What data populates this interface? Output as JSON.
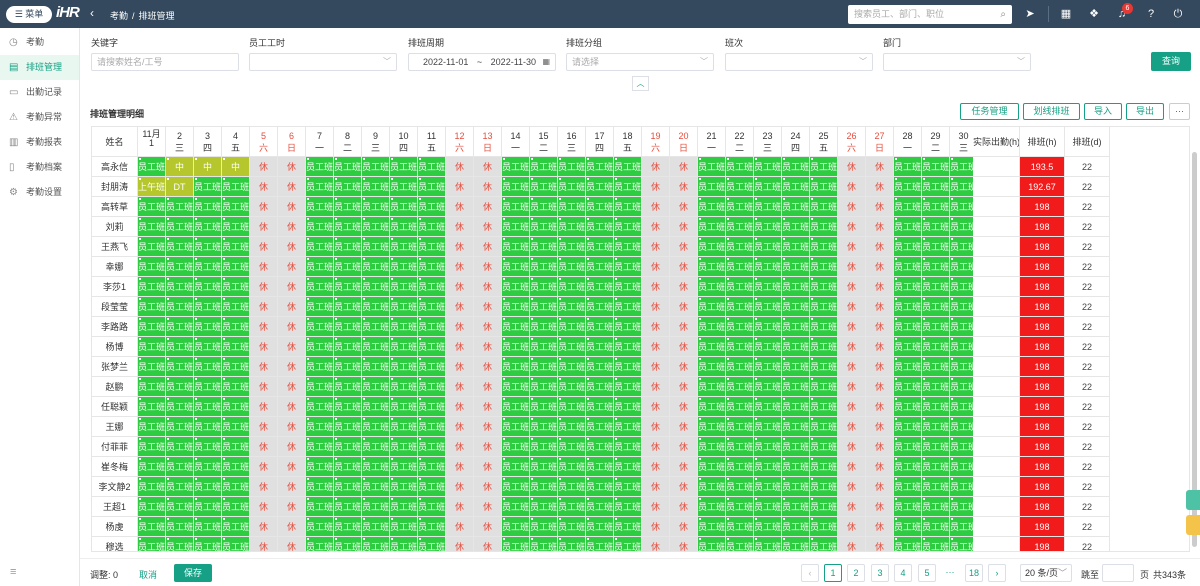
{
  "topbar": {
    "menu_label": "☰ 菜单",
    "logo": "iHR",
    "crumbs": [
      "考勤",
      "排班管理"
    ],
    "search_placeholder": "搜索员工、部门、职位",
    "notification_count": "6"
  },
  "sidebar": {
    "items": [
      {
        "label": "考勤",
        "icon": "clock-icon"
      },
      {
        "label": "排班管理",
        "icon": "calendar-icon",
        "active": true
      },
      {
        "label": "出勤记录",
        "icon": "list-icon"
      },
      {
        "label": "考勤异常",
        "icon": "alert-icon"
      },
      {
        "label": "考勤报表",
        "icon": "chart-icon"
      },
      {
        "label": "考勤档案",
        "icon": "file-icon"
      },
      {
        "label": "考勤设置",
        "icon": "gear-icon"
      }
    ]
  },
  "filters": {
    "keyword_label": "关键字",
    "keyword_placeholder": "请搜索姓名/工号",
    "hours_label": "员工工时",
    "period_label": "排班周期",
    "date_from": "2022-11-01",
    "date_sep": "~",
    "date_to": "2022-11-30",
    "group_label": "排班分组",
    "group_placeholder": "请选择",
    "shift_label": "班次",
    "dept_label": "部门",
    "query_label": "查询"
  },
  "panel": {
    "title": "排班管理明细",
    "buttons": [
      "任务管理",
      "划线排班",
      "导入",
      "导出",
      "···"
    ]
  },
  "table": {
    "name_header": "姓名",
    "month_label": "11月",
    "days": [
      {
        "d": "1",
        "w": "二"
      },
      {
        "d": "2",
        "w": "三"
      },
      {
        "d": "3",
        "w": "四"
      },
      {
        "d": "4",
        "w": "五"
      },
      {
        "d": "5",
        "w": "六"
      },
      {
        "d": "6",
        "w": "日"
      },
      {
        "d": "7",
        "w": "一"
      },
      {
        "d": "8",
        "w": "二"
      },
      {
        "d": "9",
        "w": "三"
      },
      {
        "d": "10",
        "w": "四"
      },
      {
        "d": "11",
        "w": "五"
      },
      {
        "d": "12",
        "w": "六"
      },
      {
        "d": "13",
        "w": "日"
      },
      {
        "d": "14",
        "w": "一"
      },
      {
        "d": "15",
        "w": "二"
      },
      {
        "d": "16",
        "w": "三"
      },
      {
        "d": "17",
        "w": "四"
      },
      {
        "d": "18",
        "w": "五"
      },
      {
        "d": "19",
        "w": "六"
      },
      {
        "d": "20",
        "w": "日"
      },
      {
        "d": "21",
        "w": "一"
      },
      {
        "d": "22",
        "w": "二"
      },
      {
        "d": "23",
        "w": "三"
      },
      {
        "d": "24",
        "w": "四"
      },
      {
        "d": "25",
        "w": "五"
      },
      {
        "d": "26",
        "w": "六"
      },
      {
        "d": "27",
        "w": "日"
      },
      {
        "d": "28",
        "w": "一"
      },
      {
        "d": "29",
        "w": "二"
      },
      {
        "d": "30",
        "w": "三"
      }
    ],
    "col_actual": "实际出勤(h)",
    "col_sched_h": "排班(h)",
    "col_sched_d": "排班(d)",
    "work_label": "员工班",
    "rest_label": "休",
    "rows": [
      {
        "name": "高永信",
        "special": [
          "员工班",
          "中",
          "中",
          "中"
        ],
        "h": "193.5",
        "d": "22"
      },
      {
        "name": "封朋涛",
        "special": [
          "上午班",
          "DT",
          "员工班",
          "员工班"
        ],
        "h": "192.67",
        "d": "22"
      },
      {
        "name": "高转草",
        "h": "198",
        "d": "22"
      },
      {
        "name": "刘莉",
        "h": "198",
        "d": "22"
      },
      {
        "name": "王燕飞",
        "h": "198",
        "d": "22"
      },
      {
        "name": "幸娜",
        "h": "198",
        "d": "22"
      },
      {
        "name": "李莎1",
        "h": "198",
        "d": "22"
      },
      {
        "name": "段莹莹",
        "h": "198",
        "d": "22"
      },
      {
        "name": "李路路",
        "h": "198",
        "d": "22"
      },
      {
        "name": "杨博",
        "h": "198",
        "d": "22"
      },
      {
        "name": "张梦兰",
        "h": "198",
        "d": "22"
      },
      {
        "name": "赵鹏",
        "h": "198",
        "d": "22"
      },
      {
        "name": "任聪颖",
        "h": "198",
        "d": "22"
      },
      {
        "name": "王娜",
        "h": "198",
        "d": "22"
      },
      {
        "name": "付菲菲",
        "h": "198",
        "d": "22"
      },
      {
        "name": "崔冬梅",
        "h": "198",
        "d": "22"
      },
      {
        "name": "李文静2",
        "h": "198",
        "d": "22"
      },
      {
        "name": "王超1",
        "h": "198",
        "d": "22"
      },
      {
        "name": "杨虔",
        "h": "198",
        "d": "22"
      },
      {
        "name": "穆选",
        "h": "198",
        "d": "22"
      }
    ]
  },
  "footer": {
    "adjust_label": "调整:",
    "adjust_count": "0",
    "cancel_label": "取消",
    "save_label": "保存",
    "pages": [
      "1",
      "2",
      "3",
      "4",
      "5",
      "···",
      "18"
    ],
    "page_size": "20 条/页",
    "jump_label": "跳至",
    "page_unit": "页",
    "total": "共343条"
  }
}
